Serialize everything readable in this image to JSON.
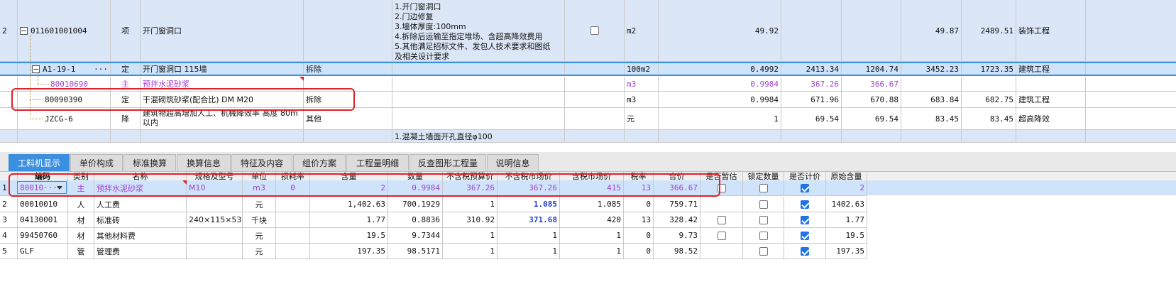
{
  "top_grid": {
    "rows": [
      {
        "idx": "2",
        "code": "011601001004",
        "type": "项",
        "name": "开门窗洞口",
        "spec": "",
        "features": [
          "1.开门窗洞口",
          "2.门边修复",
          "3.墙体厚度:100mm",
          "4.拆除后运输至指定堆场、含超高降效费用",
          "5.其他满足招标文件、发包人技术要求和图纸",
          "及相关设计要求"
        ],
        "unit": "m2",
        "qty": "49.92",
        "c1": "",
        "c2": "",
        "c3": "49.87",
        "c4": "2489.51",
        "category": "装饰工程"
      },
      {
        "idx": "",
        "code": "A1-19-1",
        "more": "···",
        "type": "定",
        "name": "开门窗洞口 115墙",
        "spec": "拆除",
        "features": [],
        "unit": "100m2",
        "qty": "0.4992",
        "c1": "2413.34",
        "c2": "1204.74",
        "c3": "3452.23",
        "c4": "1723.35",
        "category": "建筑工程"
      },
      {
        "idx": "",
        "code": "80010690",
        "type": "主",
        "name": "预拌水泥砂浆",
        "spec": "",
        "features": [],
        "unit": "m3",
        "qty": "0.9984",
        "c1": "367.26",
        "c2": "366.67",
        "c3": "",
        "c4": "",
        "category": ""
      },
      {
        "idx": "",
        "code": "80090390",
        "type": "定",
        "name": "干混砌筑砂浆(配合比) DM M20",
        "spec": "拆除",
        "features": [],
        "unit": "m3",
        "qty": "0.9984",
        "c1": "671.96",
        "c2": "670.88",
        "c3": "683.84",
        "c4": "682.75",
        "category": "建筑工程"
      },
      {
        "idx": "",
        "code": "JZCG-6",
        "type": "降",
        "name": "建筑物超高增加人工、机械降效率 高度 80m以内",
        "spec": "其他",
        "features": [],
        "unit": "元",
        "qty": "1",
        "c1": "69.54",
        "c2": "69.54",
        "c3": "83.45",
        "c4": "83.45",
        "category": "超高降效"
      },
      {
        "idx": "",
        "code": "",
        "type": "",
        "name": "",
        "spec": "",
        "features": [
          "1.混凝土墙面开孔直径φ100"
        ],
        "unit": "",
        "qty": "",
        "c1": "",
        "c2": "",
        "c3": "",
        "c4": "",
        "category": ""
      }
    ]
  },
  "tabs": [
    {
      "label": "工料机显示",
      "active": true
    },
    {
      "label": "单价构成"
    },
    {
      "label": "标准换算"
    },
    {
      "label": "换算信息"
    },
    {
      "label": "特征及内容"
    },
    {
      "label": "组价方案"
    },
    {
      "label": "工程量明细"
    },
    {
      "label": "反查图形工程量"
    },
    {
      "label": "说明信息"
    }
  ],
  "bottom_grid": {
    "headers": [
      "编码",
      "类别",
      "名称",
      "规格及型号",
      "单位",
      "损耗率",
      "含量",
      "数量",
      "不含税预算价",
      "不含税市场价",
      "含税市场价",
      "税率",
      "合价",
      "是否暂估",
      "锁定数量",
      "是否计价",
      "原始含量"
    ],
    "rows": [
      {
        "idx": "1",
        "code": "80010···",
        "type": "主",
        "name": "预拌水泥砂浆",
        "spec": "M10",
        "unit": "m3",
        "loss": "0",
        "content": "2",
        "qty": "0.9984",
        "p1": "367.26",
        "p2": "367.26",
        "p3": "415",
        "tax": "13",
        "total": "366.67",
        "est": false,
        "lock": false,
        "priced": true,
        "orig": "2"
      },
      {
        "idx": "2",
        "code": "00010010",
        "type": "人",
        "name": "人工费",
        "spec": "",
        "unit": "元",
        "loss": "",
        "content": "1,402.63",
        "qty": "700.1929",
        "p1": "1",
        "p2": "1.085",
        "p3": "1.085",
        "tax": "0",
        "total": "759.71",
        "est": null,
        "lock": false,
        "priced": true,
        "orig": "1402.63"
      },
      {
        "idx": "3",
        "code": "04130001",
        "type": "材",
        "name": "标准砖",
        "spec": "240×115×53",
        "unit": "千块",
        "loss": "",
        "content": "1.77",
        "qty": "0.8836",
        "p1": "310.92",
        "p2": "371.68",
        "p3": "420",
        "tax": "13",
        "total": "328.42",
        "est": false,
        "lock": false,
        "priced": true,
        "orig": "1.77"
      },
      {
        "idx": "4",
        "code": "99450760",
        "type": "材",
        "name": "其他材料费",
        "spec": "",
        "unit": "元",
        "loss": "",
        "content": "19.5",
        "qty": "9.7344",
        "p1": "1",
        "p2": "1",
        "p3": "1",
        "tax": "0",
        "total": "9.73",
        "est": false,
        "lock": false,
        "priced": true,
        "orig": "19.5"
      },
      {
        "idx": "5",
        "code": "GLF",
        "type": "管",
        "name": "管理费",
        "spec": "",
        "unit": "元",
        "loss": "",
        "content": "197.35",
        "qty": "98.5171",
        "p1": "1",
        "p2": "1",
        "p3": "1",
        "tax": "0",
        "total": "98.52",
        "est": null,
        "lock": false,
        "priced": true,
        "orig": "197.35"
      }
    ]
  },
  "colors": {
    "selected_row": "#cfe3fb",
    "active_tab": "#3b8fe0",
    "highlight_red": "#e0202a",
    "purple_text": "#a13fd0",
    "bold_blue": "#1e3fd8"
  }
}
